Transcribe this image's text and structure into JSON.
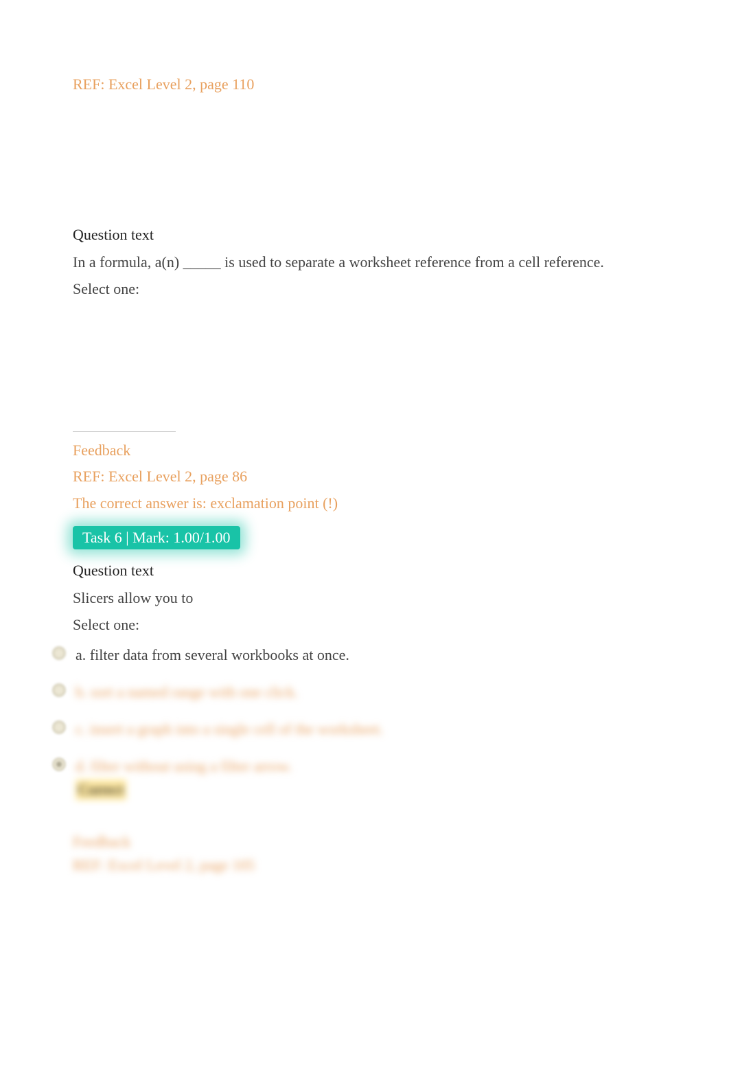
{
  "q1": {
    "ref": "REF: Excel Level 2, page 110",
    "heading": "Question text",
    "body": "In a formula, a(n) _____ is used to separate a worksheet reference from a cell reference.",
    "selectOne": "Select one:"
  },
  "fb1": {
    "feedbackHeading": "Feedback",
    "ref": "REF: Excel Level 2, page 86",
    "correctAnswer": "The correct answer is: exclamation point (!)"
  },
  "task": {
    "badge": "Task 6 | Mark: 1.00/1.00"
  },
  "q2": {
    "heading": "Question text",
    "body": "Slicers allow you to",
    "selectOne": "Select one:",
    "options": {
      "a": "a. filter data from several workbooks at once.",
      "b": "b. sort a named range with one click.",
      "c": "c. insert a graph into a single cell of the worksheet.",
      "d": "d. filter without using a filter arrow."
    },
    "correctLabel": "Correct"
  },
  "fb2": {
    "feedbackHeading": "Feedback",
    "ref": "REF: Excel Level 2, page 105"
  }
}
